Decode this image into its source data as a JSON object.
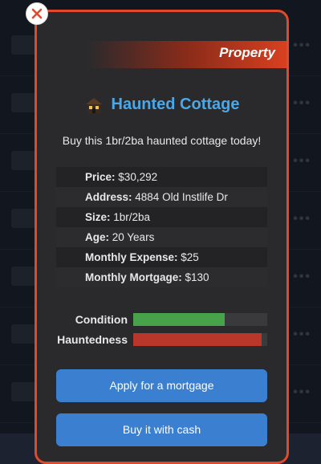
{
  "modal": {
    "header_title": "Property",
    "title": "Haunted Cottage",
    "subtitle": "Buy this 1br/2ba haunted cottage today!"
  },
  "details": [
    {
      "label": "Price:",
      "value": "$30,292"
    },
    {
      "label": "Address:",
      "value": "4884 Old Instlife Dr"
    },
    {
      "label": "Size:",
      "value": "1br/2ba"
    },
    {
      "label": "Age:",
      "value": "20 Years"
    },
    {
      "label": "Monthly Expense:",
      "value": "$25"
    },
    {
      "label": "Monthly Mortgage:",
      "value": "$130"
    }
  ],
  "stats": {
    "condition": {
      "label": "Condition",
      "fraction": 0.68,
      "color": "#47a24a"
    },
    "hauntedness": {
      "label": "Hauntedness",
      "fraction": 0.96,
      "color": "#b8372a"
    }
  },
  "buttons": {
    "mortgage": "Apply for a mortgage",
    "cash": "Buy it with cash"
  },
  "colors": {
    "accent": "#e0492b",
    "title": "#4aa8e8",
    "button": "#3a7fd0"
  },
  "icons": {
    "close": "close-icon",
    "house": "haunted-house-icon"
  }
}
